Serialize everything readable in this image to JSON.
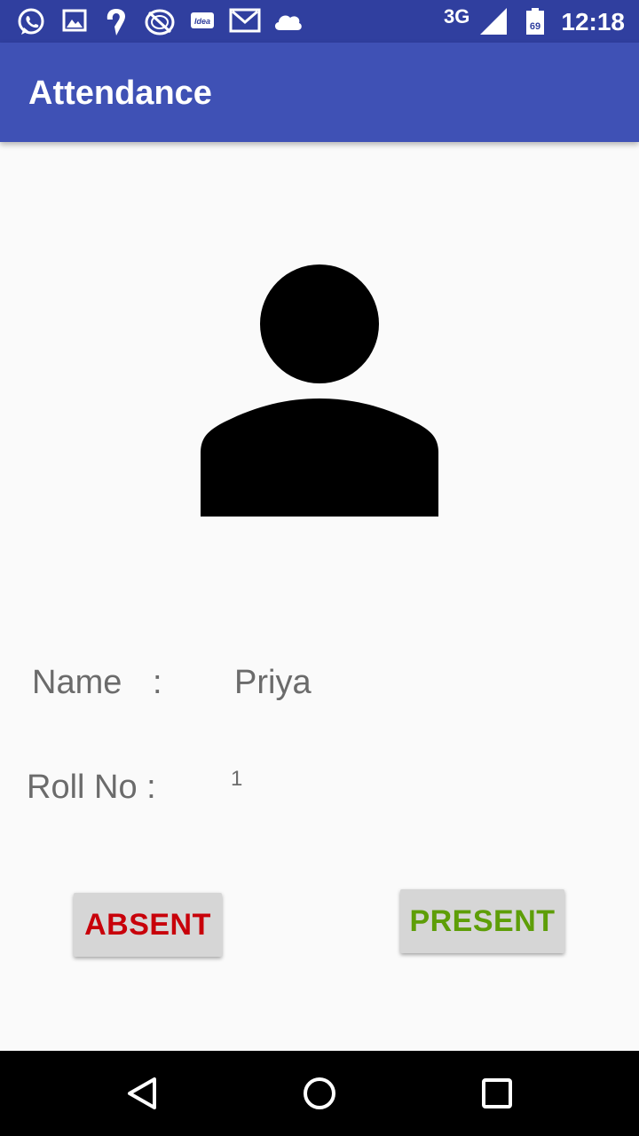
{
  "status_bar": {
    "network": "3G",
    "battery_level": "69",
    "time": "12:18",
    "icons": [
      "whatsapp-icon",
      "gallery-icon",
      "swiggy-icon",
      "hotstar-icon",
      "idea-icon",
      "gmail-icon",
      "cloud-icon",
      "signal-icon",
      "battery-icon"
    ],
    "idea_text": "Idea"
  },
  "app_bar": {
    "title": "Attendance"
  },
  "profile": {
    "avatar_icon": "person-icon",
    "name_label": "Name",
    "name_colon": ":",
    "name_value": "Priya",
    "roll_label": "Roll No :",
    "roll_value": "1"
  },
  "actions": {
    "absent_label": "ABSENT",
    "present_label": "PRESENT",
    "absent_color": "#c8000a",
    "present_color": "#5e9e08"
  },
  "nav_bar": {
    "icons": [
      "back-icon",
      "home-icon",
      "recents-icon"
    ]
  },
  "colors": {
    "status_bar": "#303f9f",
    "app_bar": "#3f51b5",
    "background": "#fafafa"
  }
}
